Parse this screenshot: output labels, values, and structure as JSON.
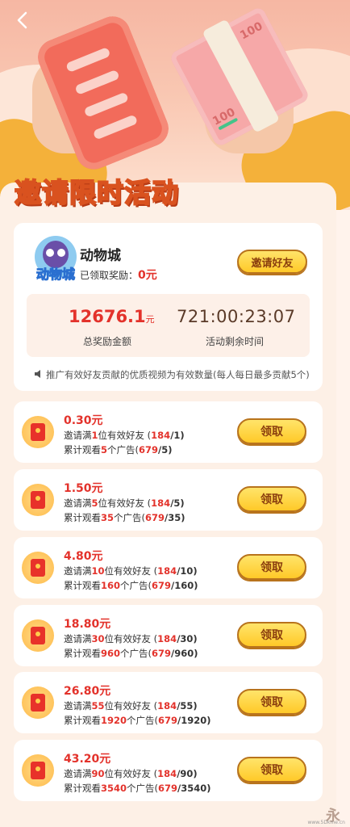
{
  "header": {
    "back_icon": "chevron-left-icon",
    "title": "邀请限时活动"
  },
  "app": {
    "name": "动物城",
    "logo_text": "动物城",
    "reward_label": "已领取奖励：",
    "reward_value": "0元",
    "invite_button": "邀请好友"
  },
  "stats": {
    "total_reward_value": "12676.1",
    "total_reward_unit": "元",
    "total_reward_label": "总奖励金额",
    "time_left_value": "721:00:23:07",
    "time_left_label": "活动剩余时间"
  },
  "notice": {
    "icon": "speaker-icon",
    "text": "推广有效好友贡献的优质视频为有效数量(每人每日最多贡献5个)"
  },
  "tasks": [
    {
      "amount": "0.30元",
      "invite_prefix": "邀请满",
      "invite_num": "1",
      "invite_suffix": "位有效好友 (",
      "invite_progress": "184",
      "invite_target": "/1)",
      "watch_prefix": "累计观看",
      "watch_num": "5",
      "watch_suffix": "个广告(",
      "watch_progress": "679",
      "watch_target": "/5)",
      "button": "领取"
    },
    {
      "amount": "1.50元",
      "invite_prefix": "邀请满",
      "invite_num": "5",
      "invite_suffix": "位有效好友 (",
      "invite_progress": "184",
      "invite_target": "/5)",
      "watch_prefix": "累计观看",
      "watch_num": "35",
      "watch_suffix": "个广告(",
      "watch_progress": "679",
      "watch_target": "/35)",
      "button": "领取"
    },
    {
      "amount": "4.80元",
      "invite_prefix": "邀请满",
      "invite_num": "10",
      "invite_suffix": "位有效好友 (",
      "invite_progress": "184",
      "invite_target": "/10)",
      "watch_prefix": "累计观看",
      "watch_num": "160",
      "watch_suffix": "个广告(",
      "watch_progress": "679",
      "watch_target": "/160)",
      "button": "领取"
    },
    {
      "amount": "18.80元",
      "invite_prefix": "邀请满",
      "invite_num": "30",
      "invite_suffix": "位有效好友 (",
      "invite_progress": "184",
      "invite_target": "/30)",
      "watch_prefix": "累计观看",
      "watch_num": "960",
      "watch_suffix": "个广告(",
      "watch_progress": "679",
      "watch_target": "/960)",
      "button": "领取"
    },
    {
      "amount": "26.80元",
      "invite_prefix": "邀请满",
      "invite_num": "55",
      "invite_suffix": "位有效好友 (",
      "invite_progress": "184",
      "invite_target": "/55)",
      "watch_prefix": "累计观看",
      "watch_num": "1920",
      "watch_suffix": "个广告(",
      "watch_progress": "679",
      "watch_target": "/1920)",
      "button": "领取"
    },
    {
      "amount": "43.20元",
      "invite_prefix": "邀请满",
      "invite_num": "90",
      "invite_suffix": "位有效好友 (",
      "invite_progress": "184",
      "invite_target": "/90)",
      "watch_prefix": "累计观看",
      "watch_num": "3540",
      "watch_suffix": "个广告(",
      "watch_progress": "679",
      "watch_target": "/3540)",
      "button": "领取"
    }
  ],
  "hero": {
    "cash_label_1": "100",
    "cash_label_2": "100"
  },
  "watermark": {
    "glyph": "永",
    "site": "www.5Dkme.cn"
  }
}
